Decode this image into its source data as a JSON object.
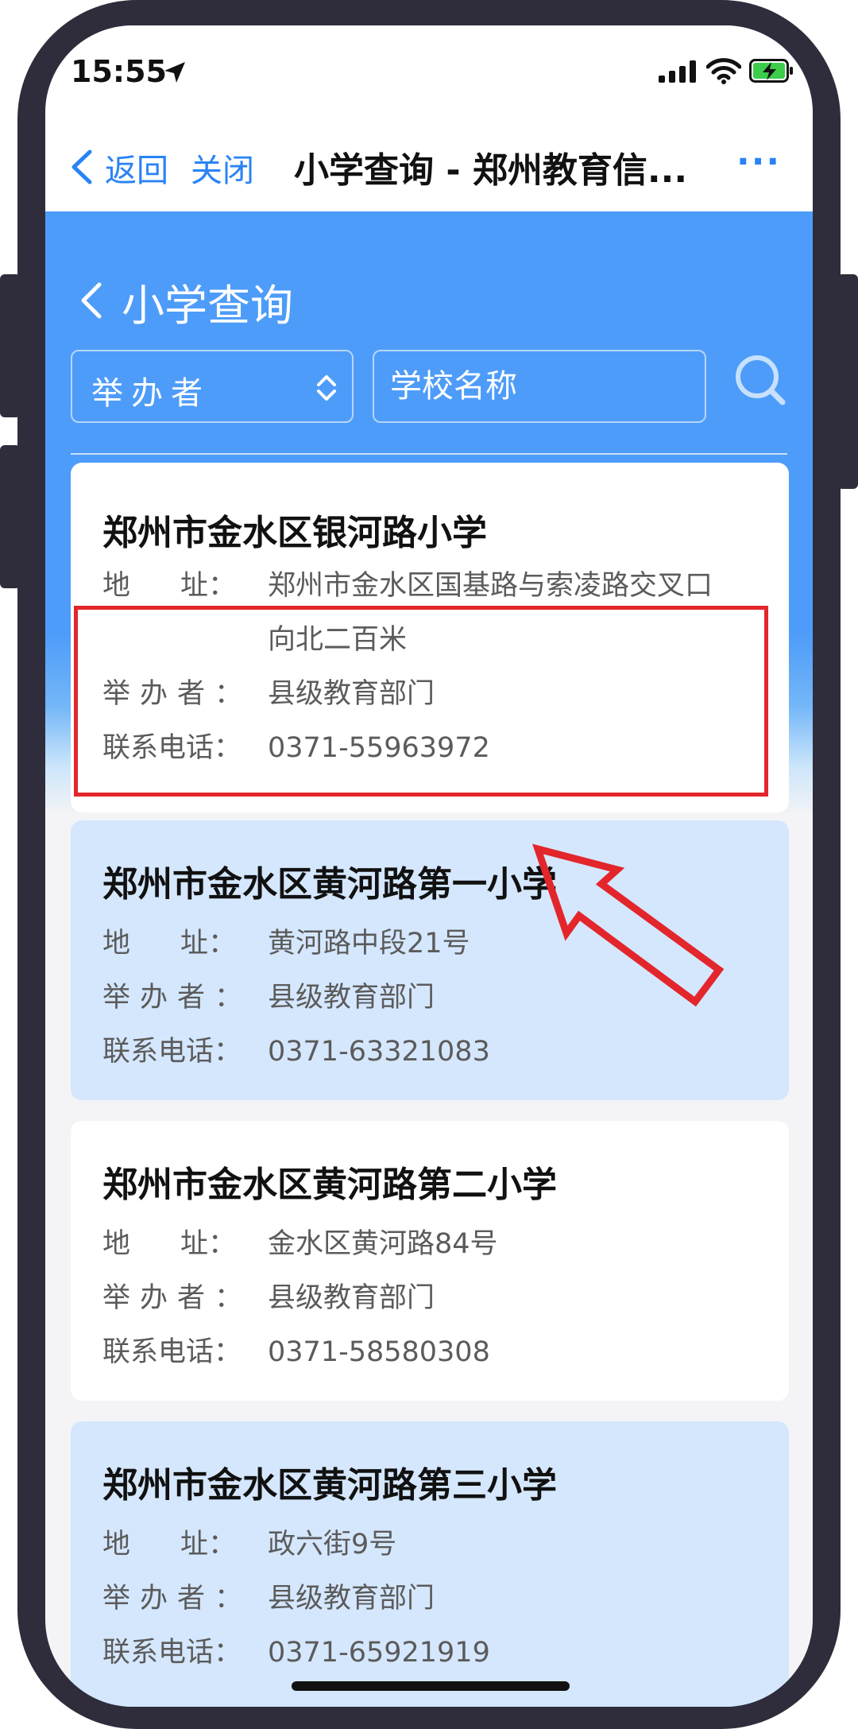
{
  "status_bar": {
    "time": "15:55"
  },
  "nav": {
    "back_label": "返回",
    "close_label": "关闭",
    "title": "小学查询 - 郑州教育信...",
    "more_label": "···"
  },
  "page": {
    "title": "小学查询"
  },
  "filters": {
    "sponsor_select": "举办者",
    "search_placeholder": "学校名称"
  },
  "labels": {
    "address": "地址：",
    "address_a": "地",
    "address_b": "址：",
    "sponsor": "举办者：",
    "phone": "联系电话："
  },
  "schools": [
    {
      "name": "郑州市金水区银河路小学",
      "address_line1": "郑州市金水区国基路与索凌路交叉口",
      "address_line2": "向北二百米",
      "sponsor": "县级教育部门",
      "phone": "0371-55963972"
    },
    {
      "name": "郑州市金水区黄河路第一小学",
      "address_line1": "黄河路中段21号",
      "sponsor": "县级教育部门",
      "phone": "0371-63321083"
    },
    {
      "name": "郑州市金水区黄河路第二小学",
      "address_line1": "金水区黄河路84号",
      "sponsor": "县级教育部门",
      "phone": "0371-58580308"
    },
    {
      "name": "郑州市金水区黄河路第三小学",
      "address_line1": "政六街9号",
      "sponsor": "县级教育部门",
      "phone": "0371-65921919"
    }
  ],
  "colors": {
    "accent": "#2a83f5",
    "header_blue": "#4e9cf9",
    "card_blue": "#d5e7fd",
    "annotation_red": "#e3262b"
  }
}
